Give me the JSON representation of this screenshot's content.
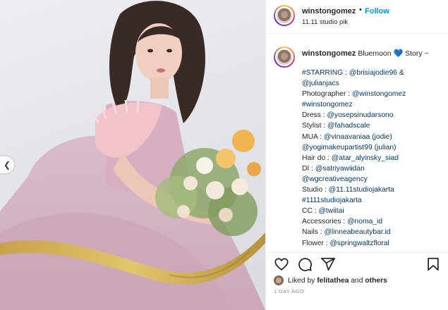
{
  "post": {
    "username": "winstongomez",
    "follow_label": "Follow",
    "location": "11.11 studio pik",
    "caption_username": "winstongomez",
    "caption_intro": "Bluemoon",
    "caption_heart": "💙",
    "caption_tail": "Story ~",
    "caption_lines": [
      {
        "label": "",
        "value": "#STARRING : @brisiajodie96 &"
      },
      {
        "label": "",
        "value": "@julianjacs"
      },
      {
        "label": "Photographer : ",
        "value": "@winstongomez"
      },
      {
        "label": "",
        "value": "#winstongomez"
      },
      {
        "label": "Dress : ",
        "value": "@yosepsinudarsono"
      },
      {
        "label": "Stylist : ",
        "value": "@fahadscale"
      },
      {
        "label": "MUA : ",
        "value": "@vinaavaniaa (jodie)"
      },
      {
        "label": "",
        "value": "@yogimakeupartist99 (julian)"
      },
      {
        "label": "Hair do : ",
        "value": "@atar_alyinsky_siad"
      },
      {
        "label": "DI : ",
        "value": "@satriyawiidan"
      },
      {
        "label": "",
        "value": "@wgcreativeagency"
      },
      {
        "label": "Studio : ",
        "value": "@11.11studiojakarta"
      },
      {
        "label": "",
        "value": "#1111studiojakarta"
      },
      {
        "label": "CC : ",
        "value": "@twiitai"
      },
      {
        "label": "Accessories : ",
        "value": "@noma_id"
      },
      {
        "label": "Nails : ",
        "value": "@linneabeautybar.id"
      },
      {
        "label": "Flower : ",
        "value": "@springwaltzfloral"
      }
    ],
    "liked_prefix": "Liked by",
    "liked_user": "felitathea",
    "liked_mid": "and",
    "liked_others": "others",
    "time_ago": "1 DAY AGO"
  },
  "icons": {
    "like": "heart-outline-icon",
    "comment": "comment-bubble-icon",
    "share": "paper-plane-icon",
    "save": "bookmark-icon",
    "prev": "chevron-left-icon"
  },
  "colors": {
    "link": "#00376b",
    "follow": "#0095f6",
    "text": "#262626",
    "muted": "#8e8e8e"
  }
}
